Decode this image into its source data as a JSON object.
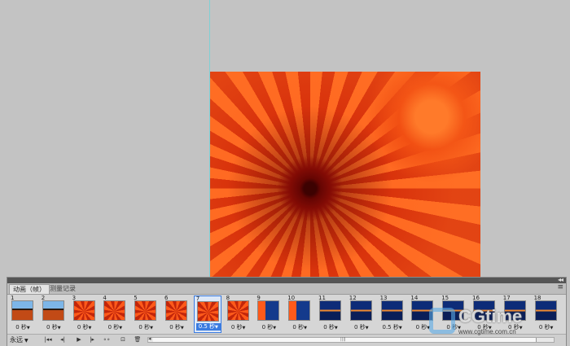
{
  "panel": {
    "tabs": [
      {
        "label": "动画（帧）"
      },
      {
        "label": "测量记录"
      }
    ]
  },
  "frames": [
    {
      "num": "1",
      "delay": "0 秒",
      "thumb": "a"
    },
    {
      "num": "2",
      "delay": "0 秒",
      "thumb": "a"
    },
    {
      "num": "3",
      "delay": "0 秒",
      "thumb": "b"
    },
    {
      "num": "4",
      "delay": "0 秒",
      "thumb": "b"
    },
    {
      "num": "5",
      "delay": "0 秒",
      "thumb": "b"
    },
    {
      "num": "6",
      "delay": "0 秒",
      "thumb": "b"
    },
    {
      "num": "7",
      "delay": "0.5 秒",
      "thumb": "b",
      "selected": true
    },
    {
      "num": "8",
      "delay": "0 秒",
      "thumb": "b"
    },
    {
      "num": "9",
      "delay": "0 秒",
      "thumb": "c"
    },
    {
      "num": "10",
      "delay": "0 秒",
      "thumb": "c"
    },
    {
      "num": "11",
      "delay": "0 秒",
      "thumb": "d"
    },
    {
      "num": "12",
      "delay": "0 秒",
      "thumb": "d"
    },
    {
      "num": "13",
      "delay": "0.5 秒",
      "thumb": "d"
    },
    {
      "num": "14",
      "delay": "0 秒",
      "thumb": "d"
    },
    {
      "num": "15",
      "delay": "0 秒",
      "thumb": "d"
    },
    {
      "num": "16",
      "delay": "0 秒",
      "thumb": "d"
    },
    {
      "num": "17",
      "delay": "0 秒",
      "thumb": "d"
    },
    {
      "num": "18",
      "delay": "0 秒",
      "thumb": "d"
    }
  ],
  "controls": {
    "loop_label": "永远",
    "icons": [
      "first-frame-icon",
      "prev-frame-icon",
      "play-icon",
      "next-frame-icon",
      "tween-icon",
      "new-frame-icon",
      "delete-frame-icon"
    ]
  },
  "watermark": {
    "text": "CGtime",
    "url": "www.cgtime.com.cn"
  },
  "colors": {
    "accent": "#3a7be0",
    "panel_bg": "#d6d6d6",
    "workspace_bg": "#c3c3c3"
  }
}
